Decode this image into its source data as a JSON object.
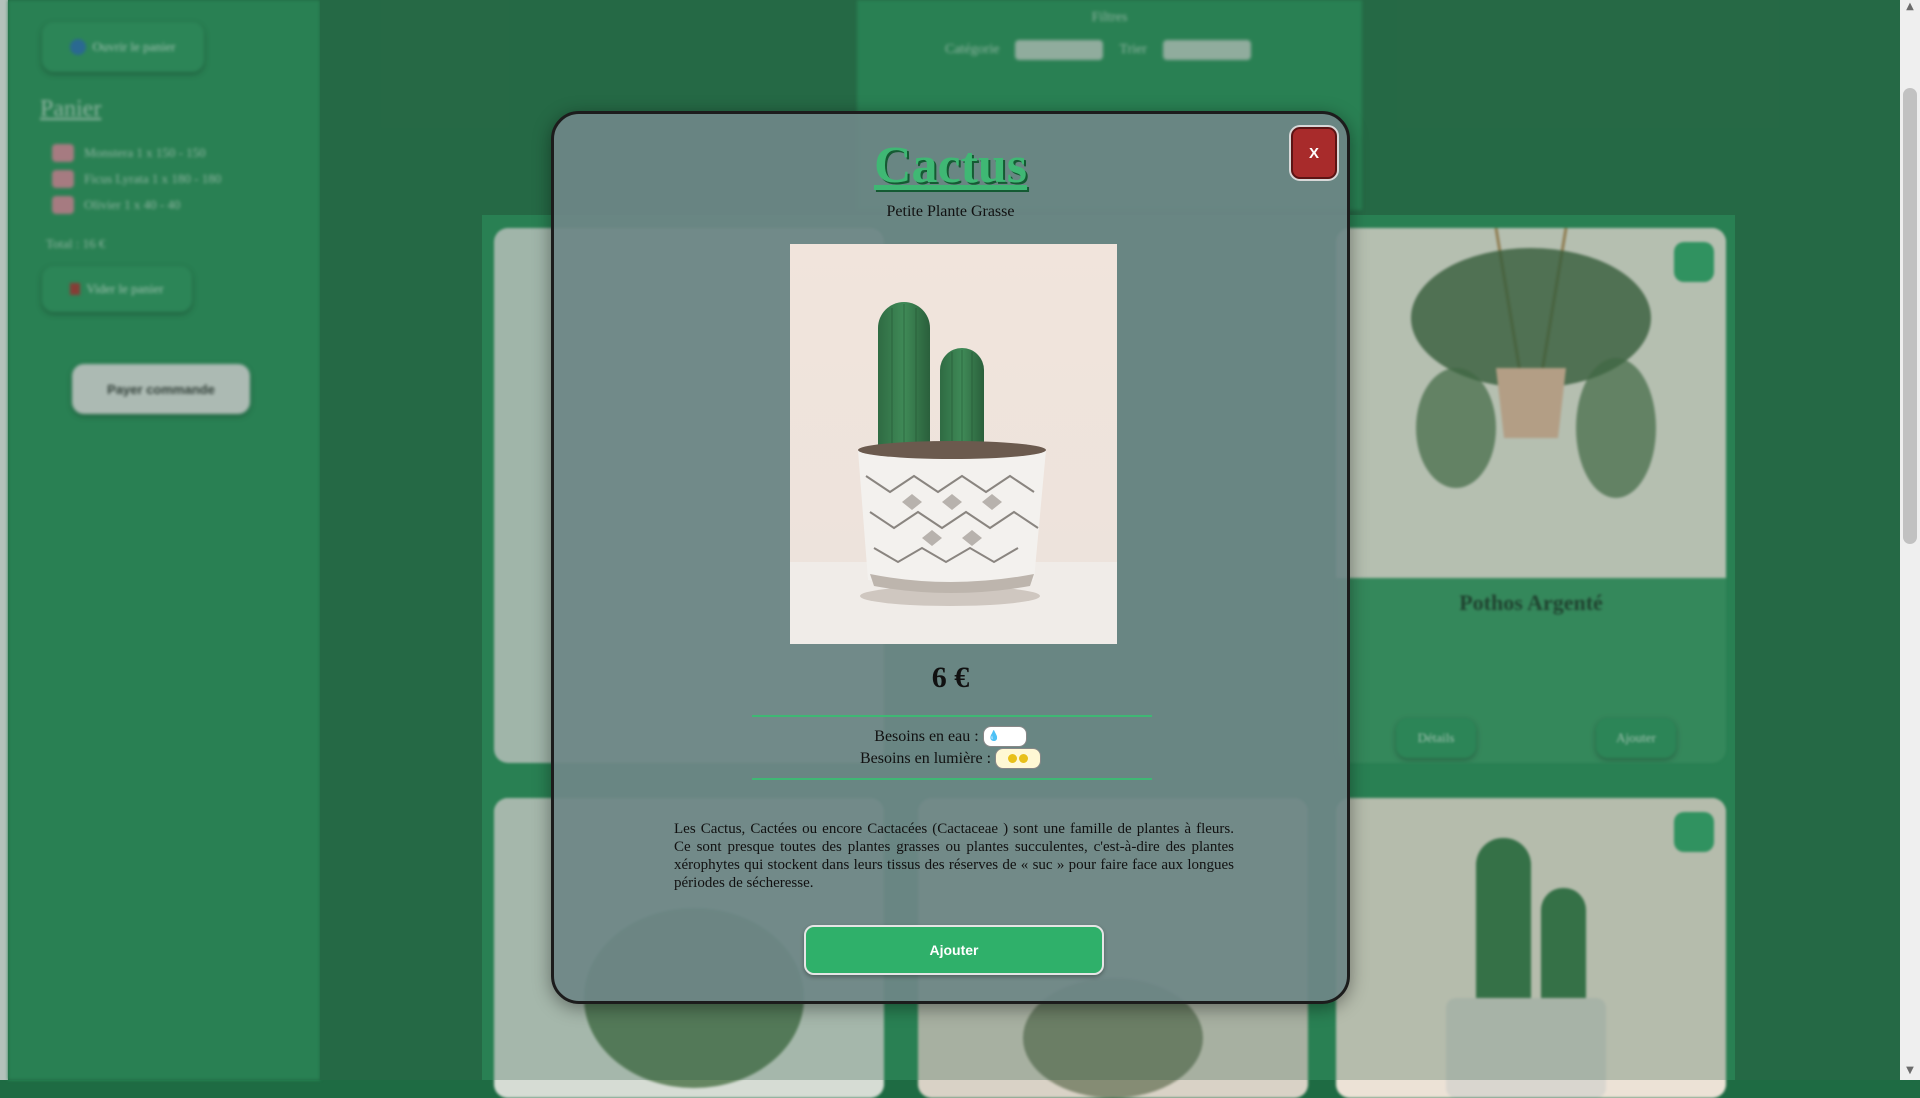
{
  "sidebar": {
    "cart_button_label": "Ouvrir le panier",
    "cart_title": "Panier",
    "cart_items": [
      {
        "label": "Monstera 1 x 150 - 150"
      },
      {
        "label": "Ficus Lyrata 1 x 180 - 180"
      },
      {
        "label": "Olivier 1 x 40 - 40"
      }
    ],
    "total_label": "Total : 16 €",
    "clear_cart_label": "Vider le panier",
    "checkout_label": "Payer commande"
  },
  "filters": {
    "title": "Filtres",
    "category_label": "Catégorie",
    "sort_label": "Trier"
  },
  "cards": [
    {
      "name": "Pothos Argenté"
    }
  ],
  "card_buttons": {
    "detail": "Détails",
    "add": "Ajouter"
  },
  "modal": {
    "close_label": "X",
    "title": "Cactus",
    "subtitle": "Petite Plante Grasse",
    "price": "6 €",
    "water_label": "Besoins en eau :",
    "water_level": 1,
    "light_label": "Besoins en lumière :",
    "light_level": 2,
    "description": "Les Cactus, Cactées ou encore Cactacées (Cactaceae ) sont une famille de plantes à fleurs. Ce sont presque toutes des plantes grasses ou plantes succulentes, c'est-à-dire des plantes xérophytes qui stockent dans leurs tissus des réserves de « suc » pour faire face aux longues périodes de sécheresse.",
    "add_button_label": "Ajouter"
  },
  "icons": {
    "close": "close-icon",
    "water": "water-drop-icon",
    "light": "sun-icon"
  },
  "colors": {
    "accent": "#2fb06a",
    "close": "#a82b2b",
    "title": "#3fb874"
  }
}
